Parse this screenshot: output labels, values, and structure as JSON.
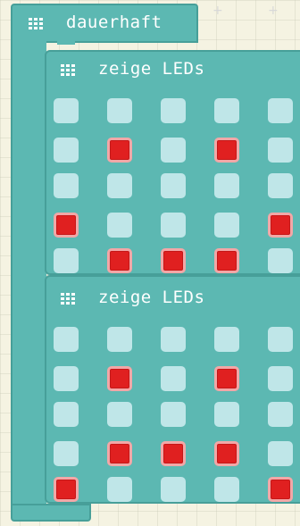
{
  "forever_block": {
    "label": "dauerhaft",
    "color": "#5cb8b2"
  },
  "blocks": [
    {
      "label": "zeige LEDs",
      "leds": [
        [
          0,
          0,
          0,
          0,
          0
        ],
        [
          0,
          1,
          0,
          1,
          0
        ],
        [
          0,
          0,
          0,
          0,
          0
        ],
        [
          1,
          0,
          0,
          0,
          1
        ],
        [
          0,
          1,
          1,
          1,
          0
        ]
      ]
    },
    {
      "label": "zeige LEDs",
      "leds": [
        [
          0,
          0,
          0,
          0,
          0
        ],
        [
          0,
          1,
          0,
          1,
          0
        ],
        [
          0,
          0,
          0,
          0,
          0
        ],
        [
          0,
          1,
          1,
          1,
          0
        ],
        [
          1,
          0,
          0,
          0,
          1
        ]
      ]
    }
  ],
  "icons": {
    "block_icon": "led-grid-icon",
    "canvas_marker": "plus-icon"
  },
  "colors": {
    "block": "#5cb8b2",
    "block_border": "#479f99",
    "led_on": "#e02020",
    "led_off": "#bfe6e8",
    "workspace": "#f5f3e2"
  }
}
